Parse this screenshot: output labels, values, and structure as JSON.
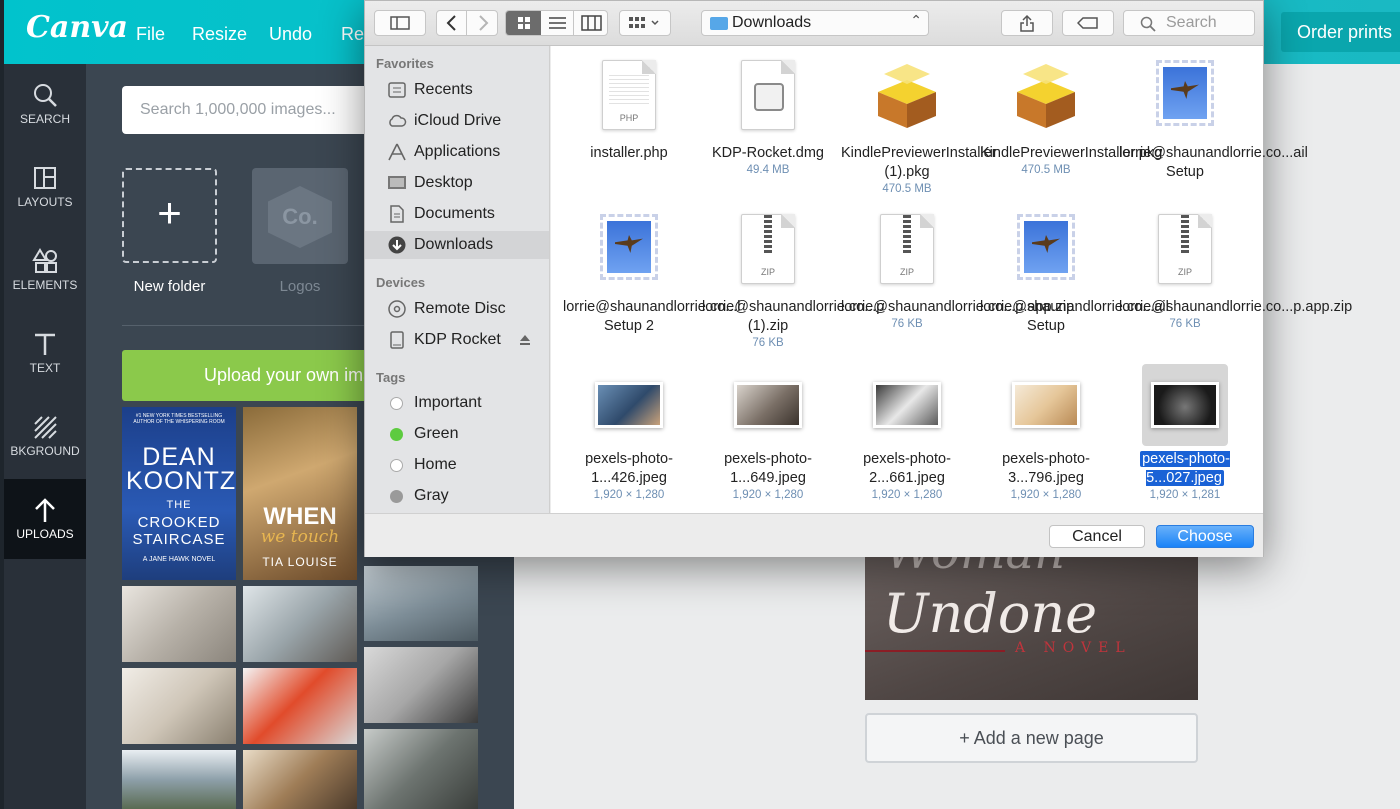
{
  "canva": {
    "logo": "Canva",
    "menu": [
      "File",
      "Resize",
      "Undo",
      "Re"
    ],
    "order_prints": "Order prints",
    "rail": [
      "SEARCH",
      "LAYOUTS",
      "ELEMENTS",
      "TEXT",
      "BKGROUND",
      "UPLOADS"
    ],
    "search_placeholder": "Search 1,000,000 images...",
    "new_folder": "New folder",
    "logos_folder": "Logos",
    "logos_glyph": "Co.",
    "upload_button": "Upload your own ima",
    "book1": {
      "top": "#1 NEW YORK TIMES BESTSELLING AUTHOR OF THE WHISPERING ROOM",
      "author": "DEAN KOONTZ",
      "title_1": "THE",
      "title_2": "CROOKED",
      "title_3": "STAIRCASE",
      "sub": "A JANE HAWK NOVEL"
    },
    "book2": {
      "title": "WHEN",
      "script": "we touch",
      "author": "TIA LOUISE"
    },
    "cover": {
      "line1": "Woman",
      "line2": "Undone",
      "line3": "A NOVEL"
    },
    "add_page": "+ Add a new page"
  },
  "dialog": {
    "location": "Downloads",
    "search_placeholder": "Search",
    "sidebar": {
      "favorites_heading": "Favorites",
      "favorites": [
        "Recents",
        "iCloud Drive",
        "Applications",
        "Desktop",
        "Documents",
        "Downloads"
      ],
      "devices_heading": "Devices",
      "devices": [
        "Remote Disc",
        "KDP Rocket"
      ],
      "tags_heading": "Tags",
      "tags": [
        {
          "label": "Important",
          "color": "#ffffff"
        },
        {
          "label": "Green",
          "color": "#5dcb3f"
        },
        {
          "label": "Home",
          "color": "#ffffff"
        },
        {
          "label": "Gray",
          "color": "#9a9a9a"
        }
      ]
    },
    "files": [
      {
        "name": "installer.php",
        "meta": "",
        "icon": "php-doc-icon",
        "kind_label": "PHP"
      },
      {
        "name": "KDP-Rocket.dmg",
        "meta": "49.4 MB",
        "icon": "disk-image-icon",
        "kind_label": ""
      },
      {
        "name": "KindlePreviewerInstaller (1).pkg",
        "meta": "470.5 MB",
        "icon": "package-icon",
        "kind_label": ""
      },
      {
        "name": "KindlePreviewerInstaller.pkg",
        "meta": "470.5 MB",
        "icon": "package-icon",
        "kind_label": ""
      },
      {
        "name": "lorrie@shaunandlorrie.co...ail Setup",
        "meta": "",
        "icon": "mail-stamp-icon",
        "kind_label": ""
      },
      {
        "name": "lorrie@shaunandlorrie.co...l Setup 2",
        "meta": "",
        "icon": "mail-stamp-icon",
        "kind_label": ""
      },
      {
        "name": "lorrie@shaunandlorrie.co...p (1).zip",
        "meta": "76 KB",
        "icon": "zip-icon",
        "kind_label": "ZIP"
      },
      {
        "name": "lorrie@shaunandlorrie.co...p.app.zip",
        "meta": "76 KB",
        "icon": "zip-icon",
        "kind_label": "ZIP"
      },
      {
        "name": "lorrie@shaunandlorrie.co...ail Setup",
        "meta": "",
        "icon": "mail-stamp-icon",
        "kind_label": ""
      },
      {
        "name": "lorrie@shaunandlorrie.co...p.app.zip",
        "meta": "76 KB",
        "icon": "zip-icon",
        "kind_label": "ZIP"
      },
      {
        "name": "pexels-photo-1...426.jpeg",
        "meta": "1,920 × 1,280",
        "icon": "photo-thumbnail-icon",
        "kind_label": ""
      },
      {
        "name": "pexels-photo-1...649.jpeg",
        "meta": "1,920 × 1,280",
        "icon": "photo-thumbnail-icon",
        "kind_label": ""
      },
      {
        "name": "pexels-photo-2...661.jpeg",
        "meta": "1,920 × 1,280",
        "icon": "photo-thumbnail-icon",
        "kind_label": ""
      },
      {
        "name": "pexels-photo-3...796.jpeg",
        "meta": "1,920 × 1,280",
        "icon": "photo-thumbnail-icon",
        "kind_label": ""
      },
      {
        "name": "pexels-photo-5...027.jpeg",
        "meta": "1,920 × 1,281",
        "icon": "photo-thumbnail-icon",
        "kind_label": "",
        "selected": true
      }
    ],
    "cancel": "Cancel",
    "choose": "Choose"
  },
  "colors": {
    "canva_teal": "#01c3cc",
    "upload_green": "#8bc94b",
    "mac_blue": "#1a83f7",
    "selection_blue": "#1a62d6"
  }
}
